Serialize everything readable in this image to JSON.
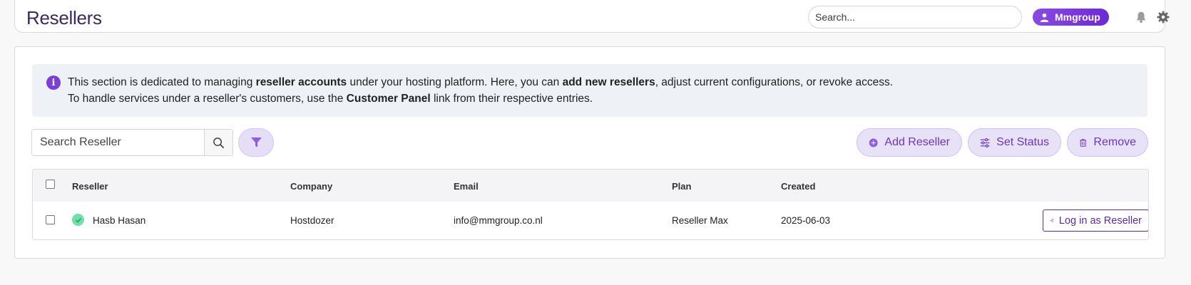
{
  "header": {
    "title": "Resellers",
    "search_placeholder": "Search...",
    "user_name": "Mmgroup"
  },
  "info": {
    "line1": [
      {
        "text": "This section is dedicated to managing ",
        "bold": false
      },
      {
        "text": "reseller accounts",
        "bold": true
      },
      {
        "text": " under your hosting platform. Here, you can ",
        "bold": false
      },
      {
        "text": "add new resellers",
        "bold": true
      },
      {
        "text": ", adjust current configurations, or revoke access.",
        "bold": false
      }
    ],
    "line2": [
      {
        "text": "To handle services under a reseller's customers, use the ",
        "bold": false
      },
      {
        "text": "Customer Panel",
        "bold": true
      },
      {
        "text": " link from their respective entries.",
        "bold": false
      }
    ]
  },
  "toolbar": {
    "search_placeholder": "Search Reseller",
    "add_label": "Add Reseller",
    "status_label": "Set Status",
    "remove_label": "Remove"
  },
  "table": {
    "columns": {
      "reseller": "Reseller",
      "company": "Company",
      "email": "Email",
      "plan": "Plan",
      "created": "Created"
    },
    "rows": [
      {
        "reseller": "Hasb Hasan",
        "company": "Hostdozer",
        "email": "info@mmgroup.co.nl",
        "plan": "Reseller Max",
        "created": "2025-06-03",
        "status": "active",
        "action_label": "Log in as Reseller"
      }
    ]
  },
  "colors": {
    "accent": "#6d28d9",
    "accent_light": "#e8e2f7",
    "info_bg": "#eef1f6",
    "success": "#6ee0a8",
    "title": "#3b2a5c"
  },
  "icons": {
    "info": "info-icon",
    "user": "user-icon",
    "bell": "bell-icon",
    "gear": "gear-icon",
    "search": "search-icon",
    "filter": "filter-icon",
    "add": "plus-circle-icon",
    "status": "sliders-icon",
    "remove": "trash-icon",
    "active": "check-circle-icon",
    "login": "sign-in-icon"
  }
}
